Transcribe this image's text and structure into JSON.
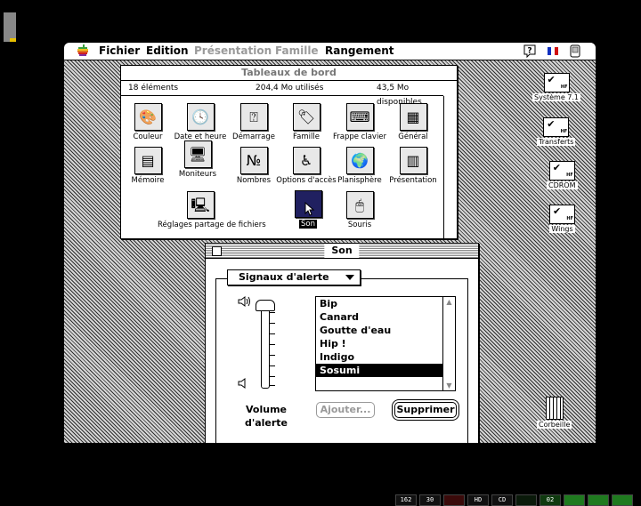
{
  "menubar": {
    "items": [
      {
        "label": "Fichier",
        "enabled": true
      },
      {
        "label": "Edition",
        "enabled": true
      },
      {
        "label": "Présentation",
        "enabled": false
      },
      {
        "label": "Famille",
        "enabled": false
      },
      {
        "label": "Rangement",
        "enabled": true
      }
    ],
    "right_icons": [
      "help-balloon-icon",
      "french-flag-icon",
      "application-menu-icon"
    ]
  },
  "control_panels": {
    "title": "Tableaux de bord",
    "info": {
      "items": "18 éléments",
      "used": "204,4 Mo utilisés",
      "free": "43,5 Mo disponibles"
    },
    "icons": [
      {
        "label": "Couleur",
        "icon": "color-palette-icon"
      },
      {
        "label": "Date et heure",
        "icon": "clock-icon"
      },
      {
        "label": "Démarrage",
        "icon": "startup-disk-icon"
      },
      {
        "label": "Famille",
        "icon": "labels-icon"
      },
      {
        "label": "Frappe clavier",
        "icon": "keyboard-icon"
      },
      {
        "label": "Général",
        "icon": "general-controls-icon"
      },
      {
        "label": "Mémoire",
        "icon": "memory-chip-icon"
      },
      {
        "label": "Moniteurs",
        "icon": "monitor-icon"
      },
      {
        "label": "Nombres",
        "icon": "numbers-icon"
      },
      {
        "label": "Options d'accès",
        "icon": "easy-access-icon"
      },
      {
        "label": "Planisphère",
        "icon": "globe-icon"
      },
      {
        "label": "Présentation",
        "icon": "views-icon"
      },
      {
        "label": "Réglages partage de fichiers",
        "icon": "file-sharing-icon"
      },
      {
        "label": "Son",
        "icon": "speaker-icon",
        "selected": true
      },
      {
        "label": "Souris",
        "icon": "mouse-icon"
      }
    ]
  },
  "sound_panel": {
    "title": "Son",
    "popup_label": "Signaux d'alerte",
    "volume_label_1": "Volume",
    "volume_label_2": "d'alerte",
    "volume_level": 1.0,
    "alerts": [
      "Bip",
      "Canard",
      "Goutte d'eau",
      "Hip !",
      "Indigo",
      "Sosumi"
    ],
    "selected_alert": "Sosumi",
    "add_button": "Ajouter...",
    "delete_button": "Supprimer"
  },
  "desktop_icons": [
    {
      "label": "Système 7.1"
    },
    {
      "label": "Transferts"
    },
    {
      "label": "CDROM"
    },
    {
      "label": "Wings"
    },
    {
      "label": "Corbeille"
    }
  ],
  "status_bar": [
    "162",
    "30",
    "",
    "HD",
    "CD",
    "",
    "02",
    "",
    "",
    ""
  ],
  "colors": {
    "status_green": "#1f7a1f",
    "status_red": "#3a0a0a",
    "selection": "#000000"
  }
}
